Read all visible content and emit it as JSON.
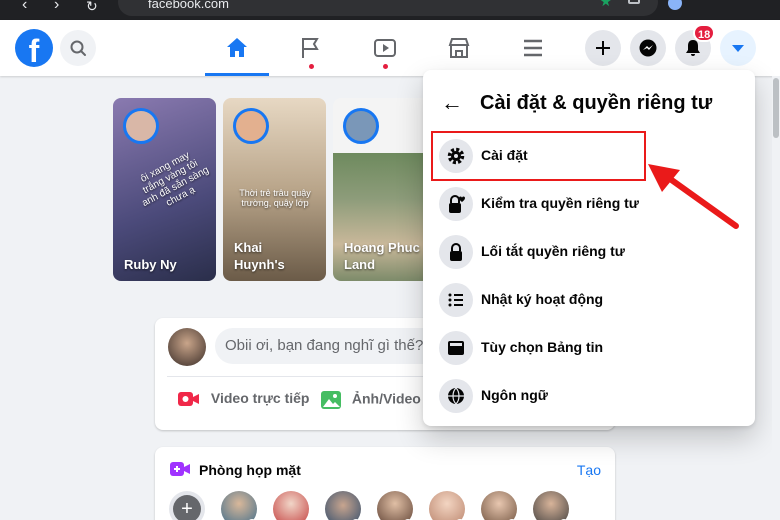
{
  "browser": {
    "url": "facebook.com"
  },
  "header": {
    "logo": "f",
    "notifications_count": "18"
  },
  "stories": [
    {
      "name": "Ruby Ny",
      "overlay": "ôi xang may trắng vàng tôi anh đã sắn sàng chưa ạ"
    },
    {
      "name": "Khai Huynh's",
      "overlay": "Thời trẻ trâu quậy trường, quậy lớp"
    },
    {
      "name": "Hoang Phuc Land",
      "overlay": ""
    }
  ],
  "composer": {
    "placeholder": "Obii ơi, bạn đang nghĩ gì thế?",
    "live_video": "Video trực tiếp",
    "photo_video": "Ảnh/Video"
  },
  "rooms": {
    "title": "Phòng họp mặt",
    "create": "Tạo"
  },
  "settings_menu": {
    "title": "Cài đặt & quyền riêng tư",
    "items": [
      {
        "label": "Cài đặt",
        "icon": "gear-icon"
      },
      {
        "label": "Kiểm tra quyền riêng tư",
        "icon": "lock-heart-icon"
      },
      {
        "label": "Lối tắt quyền riêng tư",
        "icon": "lock-icon"
      },
      {
        "label": "Nhật ký hoạt động",
        "icon": "list-icon"
      },
      {
        "label": "Tùy chọn Bảng tin",
        "icon": "feed-icon"
      },
      {
        "label": "Ngôn ngữ",
        "icon": "globe-icon"
      }
    ]
  },
  "colors": {
    "brand": "#1877f2",
    "annotation": "#ea1a1a",
    "badge": "#e41e3f"
  }
}
